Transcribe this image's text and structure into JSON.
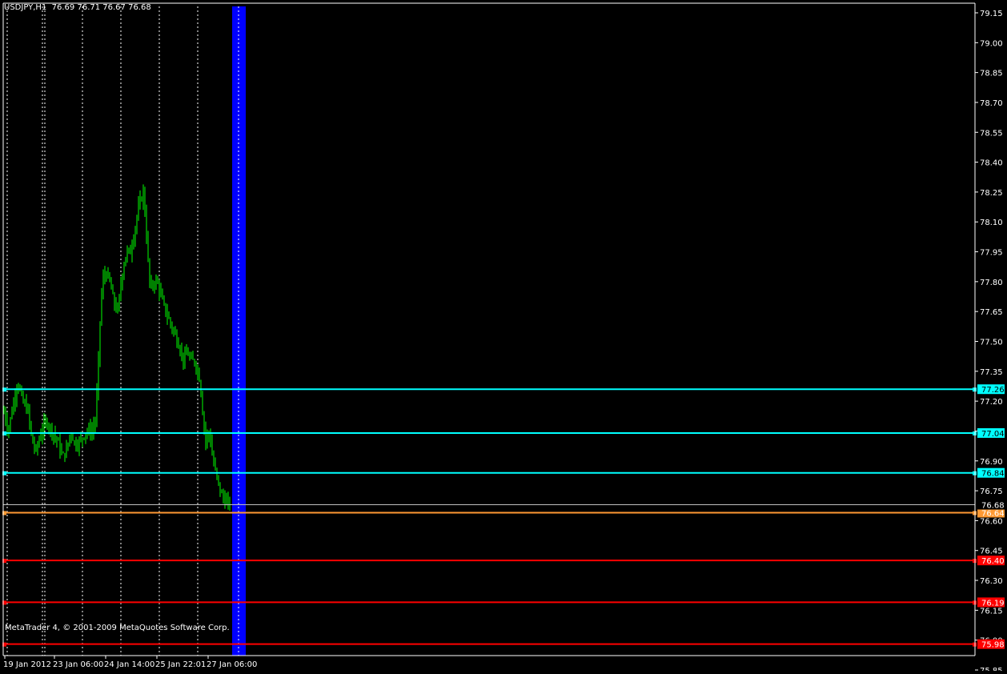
{
  "header": {
    "symbol_timeframe": "USDJPY,H1",
    "ohlc": "76.69 76.71 76.67 76.68"
  },
  "copyright": "MetaTrader 4, © 2001-2009 MetaQuotes Software Corp.",
  "colors": {
    "background": "#000000",
    "foreground": "#ffffff",
    "candles": "#00ff00",
    "resistance": "#00ffff",
    "pivot": "#ff9933",
    "support": "#ff0000",
    "current_price": "#c0c0c0",
    "future_band": "#0000ff"
  },
  "chart_data": {
    "type": "ohlc",
    "symbol": "USDJPY",
    "timeframe": "H1",
    "x_labels": [
      "19 Jan 2012",
      "23 Jan 06:00",
      "24 Jan 14:00",
      "25 Jan 22:01",
      "27 Jan 06:00"
    ],
    "y_ticks": [
      "79.15",
      "79.00",
      "78.85",
      "78.70",
      "78.55",
      "78.40",
      "78.25",
      "78.10",
      "77.95",
      "77.80",
      "77.65",
      "77.50",
      "77.35",
      "77.20",
      "77.05",
      "76.90",
      "76.75",
      "76.60",
      "76.45",
      "76.30",
      "76.15",
      "76.00",
      "75.85"
    ],
    "ylim": [
      75.81,
      79.18
    ],
    "current_price": 76.68,
    "horizontal_levels": [
      {
        "label": "77.26",
        "value": 77.26,
        "kind": "resistance"
      },
      {
        "label": "77.04",
        "value": 77.04,
        "kind": "resistance"
      },
      {
        "label": "76.84",
        "value": 76.84,
        "kind": "resistance"
      },
      {
        "label": "76.64",
        "value": 76.64,
        "kind": "pivot"
      },
      {
        "label": "76.40",
        "value": 76.4,
        "kind": "support"
      },
      {
        "label": "76.19",
        "value": 76.19,
        "kind": "support"
      },
      {
        "label": "75.98",
        "value": 75.98,
        "kind": "support"
      }
    ],
    "price_path": [
      [
        0,
        77.1
      ],
      [
        5,
        77.15
      ],
      [
        10,
        77.05
      ],
      [
        15,
        77.15
      ],
      [
        22,
        77.3
      ],
      [
        28,
        77.2
      ],
      [
        35,
        77.15
      ],
      [
        40,
        77.0
      ],
      [
        45,
        76.95
      ],
      [
        52,
        77.05
      ],
      [
        58,
        77.1
      ],
      [
        65,
        77.05
      ],
      [
        72,
        77.0
      ],
      [
        78,
        76.92
      ],
      [
        83,
        76.95
      ],
      [
        88,
        77.05
      ],
      [
        94,
        76.98
      ],
      [
        100,
        77.0
      ],
      [
        108,
        77.05
      ],
      [
        115,
        77.05
      ],
      [
        119,
        77.1
      ],
      [
        122,
        77.3
      ],
      [
        125,
        77.6
      ],
      [
        128,
        77.8
      ],
      [
        132,
        77.85
      ],
      [
        137,
        77.8
      ],
      [
        142,
        77.7
      ],
      [
        147,
        77.65
      ],
      [
        150,
        77.75
      ],
      [
        153,
        77.85
      ],
      [
        158,
        77.95
      ],
      [
        163,
        77.95
      ],
      [
        168,
        78.05
      ],
      [
        172,
        78.15
      ],
      [
        175,
        78.2
      ],
      [
        179,
        78.25
      ],
      [
        182,
        78.1
      ],
      [
        185,
        77.9
      ],
      [
        188,
        77.75
      ],
      [
        192,
        77.8
      ],
      [
        196,
        77.8
      ],
      [
        200,
        77.75
      ],
      [
        203,
        77.7
      ],
      [
        207,
        77.65
      ],
      [
        212,
        77.6
      ],
      [
        217,
        77.55
      ],
      [
        222,
        77.5
      ],
      [
        226,
        77.45
      ],
      [
        230,
        77.4
      ],
      [
        234,
        77.45
      ],
      [
        238,
        77.4
      ],
      [
        243,
        77.4
      ],
      [
        247,
        77.35
      ],
      [
        250,
        77.3
      ],
      [
        253,
        77.15
      ],
      [
        257,
        77.0
      ],
      [
        260,
        77.05
      ],
      [
        263,
        77.0
      ],
      [
        266,
        76.9
      ],
      [
        269,
        76.85
      ],
      [
        272,
        76.8
      ],
      [
        275,
        76.75
      ],
      [
        278,
        76.72
      ],
      [
        281,
        76.7
      ],
      [
        284,
        76.69
      ],
      [
        287,
        76.68
      ]
    ]
  }
}
